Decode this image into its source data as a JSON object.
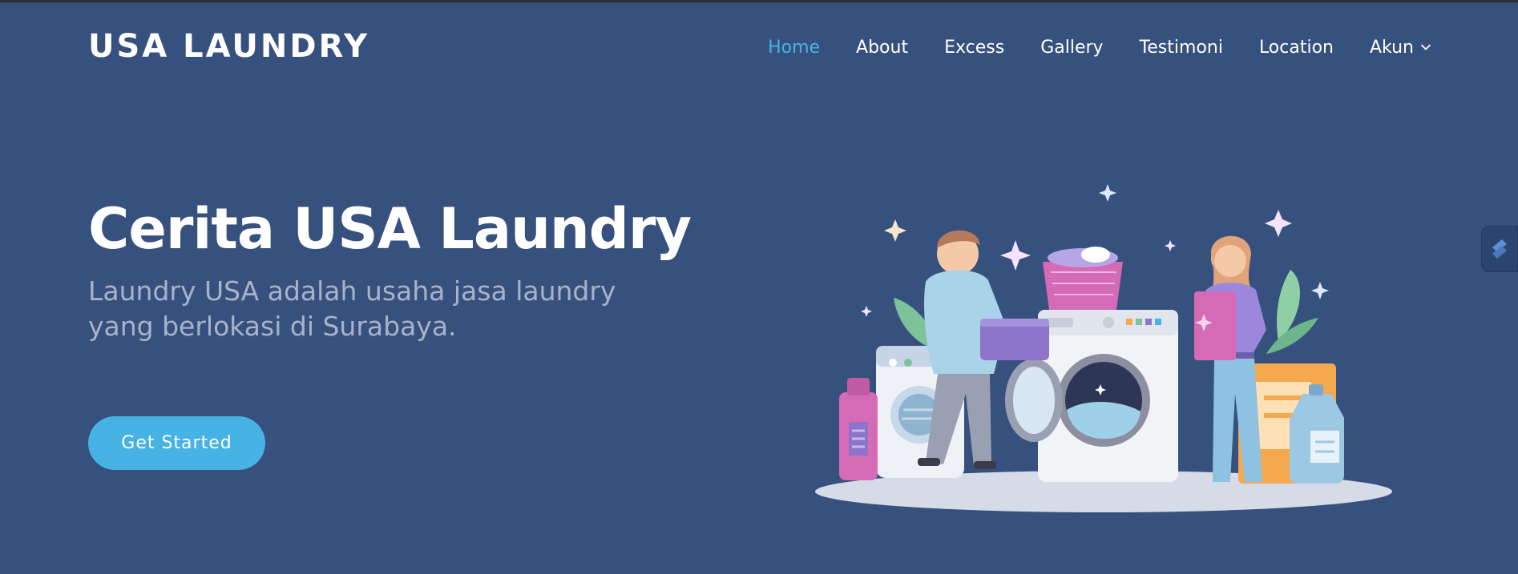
{
  "brand": {
    "name": "USA LAUNDRY"
  },
  "nav": {
    "items": [
      {
        "label": "Home",
        "active": true
      },
      {
        "label": "About",
        "active": false
      },
      {
        "label": "Excess",
        "active": false
      },
      {
        "label": "Gallery",
        "active": false
      },
      {
        "label": "Testimoni",
        "active": false
      },
      {
        "label": "Location",
        "active": false
      },
      {
        "label": "Akun",
        "active": false,
        "dropdown": true
      }
    ]
  },
  "hero": {
    "title": "Cerita USA Laundry",
    "subtitle": "Laundry USA adalah usaha jasa laundry yang berlokasi di Surabaya.",
    "cta_label": "Get Started"
  },
  "colors": {
    "background": "#37517e",
    "accent": "#47b2e4",
    "subtitle": "#a7b3c9"
  },
  "icons": {
    "dropdown": "chevron-down-icon",
    "side_widget": "widget-icon"
  }
}
